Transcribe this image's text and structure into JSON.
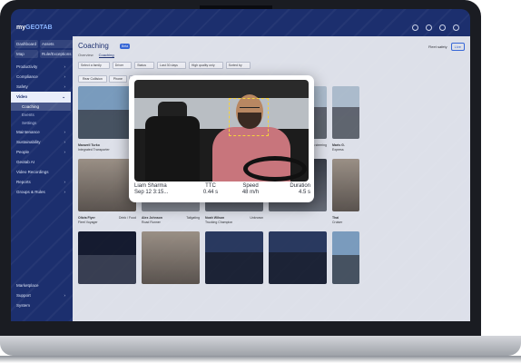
{
  "app": {
    "logo_prefix": "my",
    "logo_main": "GEOTAB"
  },
  "page": {
    "title": "Coaching",
    "badge": "Beta"
  },
  "tabs": [
    {
      "label": "Overview"
    },
    {
      "label": "Coaching"
    }
  ],
  "header_right": {
    "label": "Fleet safety",
    "button": "Live"
  },
  "sidebar": {
    "quick": [
      "Dashboard",
      "Assets",
      "Map",
      "Rule/Exceptions"
    ],
    "items": [
      {
        "label": "Productivity"
      },
      {
        "label": "Compliance"
      },
      {
        "label": "Safety"
      },
      {
        "label": "Video"
      },
      {
        "label": "Maintenance"
      },
      {
        "label": "Sustainability"
      },
      {
        "label": "People"
      },
      {
        "label": "Geotab AI"
      },
      {
        "label": "Video Recordings"
      },
      {
        "label": "Reports"
      },
      {
        "label": "Groups & Rules"
      }
    ],
    "subitems": [
      {
        "label": "Coaching"
      },
      {
        "label": "Events"
      },
      {
        "label": "Settings"
      }
    ],
    "bottom": [
      {
        "label": "Marketplace"
      },
      {
        "label": "Support"
      },
      {
        "label": "System"
      }
    ]
  },
  "filters": {
    "f1": "Select a family",
    "f2": "Driver",
    "f3": "Status",
    "f4": "Last 30 days",
    "f5": "High quality only",
    "f6": "Sorted by"
  },
  "chips": [
    "Rear Collision",
    "Phone",
    "Distraction",
    "Fatigue",
    "Drink / Food",
    "Rolling Stop",
    "Tailgating",
    "Seatbelt"
  ],
  "cards": [
    {
      "name": "Maxwell Turko",
      "vehicle": "Integrated Transporter",
      "tag": ""
    },
    {
      "name": "",
      "vehicle": "",
      "tag": ""
    },
    {
      "name": "",
      "vehicle": "",
      "tag": ""
    },
    {
      "name": "Evelyn Nason",
      "vehicle": "Cargo Cruiser",
      "tag": "Hands-on steering"
    },
    {
      "name": "Maris G.",
      "vehicle": "Express",
      "tag": ""
    },
    {
      "name": "Olivia Flyer",
      "vehicle": "Fleet Voyager",
      "tag": "Drink / Food"
    },
    {
      "name": "Alex Johnson",
      "vehicle": "Road Runner",
      "tag": "Tailgating"
    },
    {
      "name": "Noah Wilson",
      "vehicle": "Trucking Champion",
      "tag": "Unknown"
    },
    {
      "name": "Thai",
      "vehicle": "Cruiser",
      "tag": ""
    }
  ],
  "overlay": {
    "driver_label": "Liam Sharma",
    "date": "Sep 12 3:15...",
    "ttc_label": "TTC",
    "ttc_value": "0.44 s",
    "speed_label": "Speed",
    "speed_value": "48 m/h",
    "duration_label": "Duration",
    "duration_value": "4.5 s"
  }
}
